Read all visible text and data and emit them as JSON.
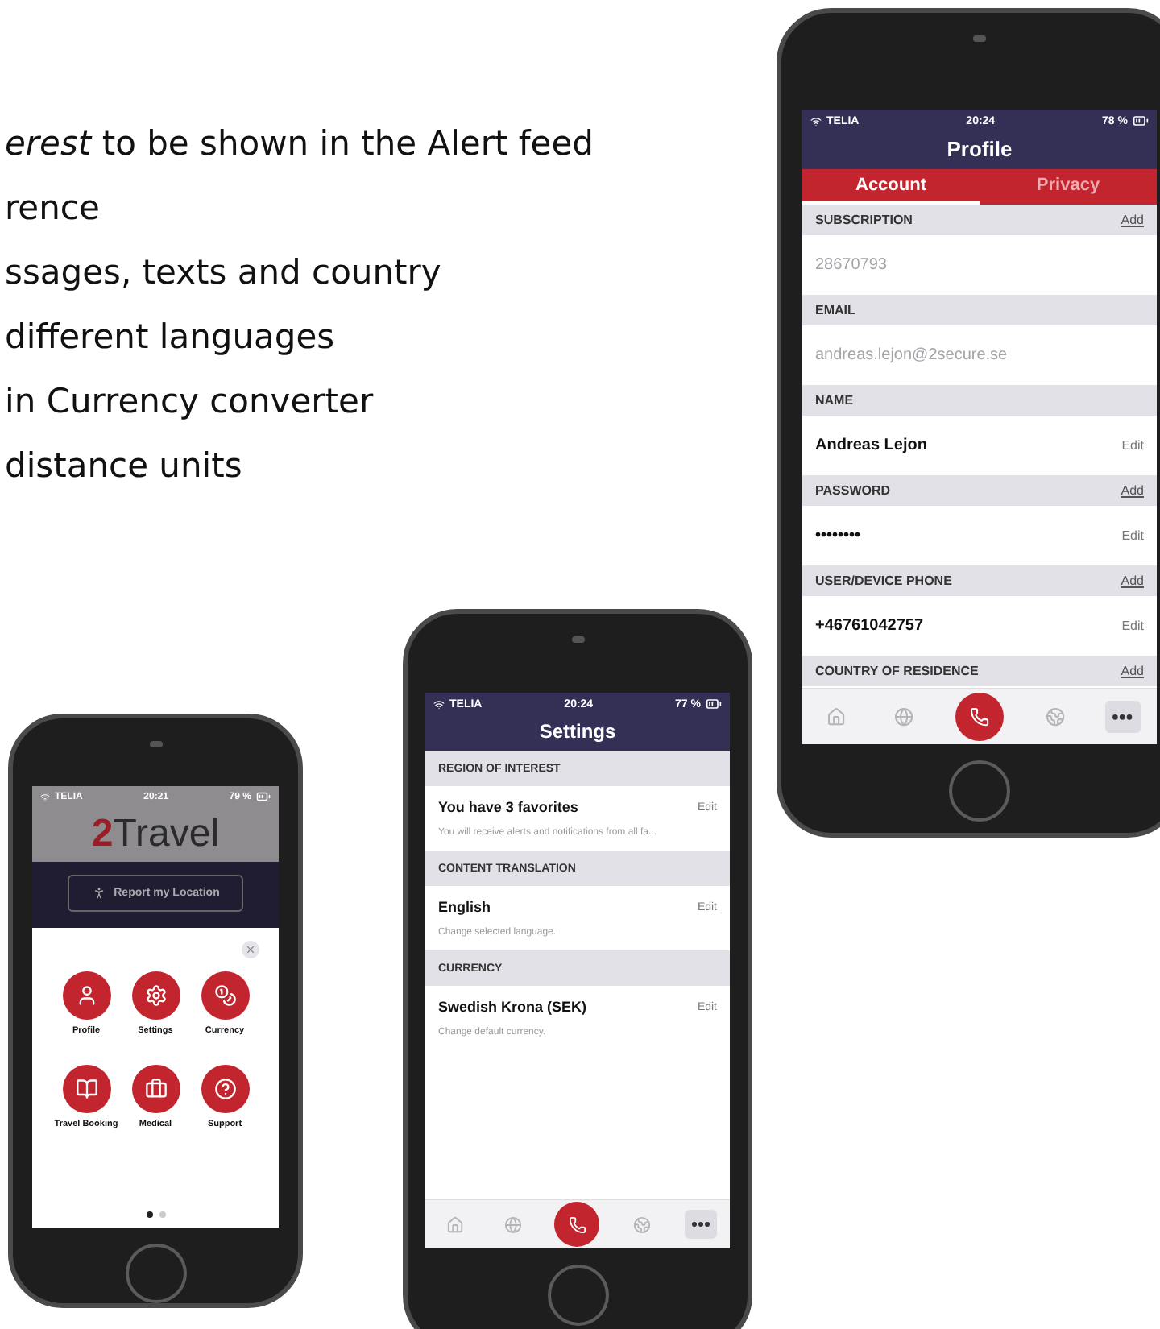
{
  "slide_text": [
    "*erest* to be shown in the Alert feed",
    "rence",
    "ssages, texts and country",
    "different languages",
    "in Currency converter",
    "distance units"
  ],
  "menu_phone": {
    "status": {
      "carrier": "TELIA",
      "time": "20:21",
      "battery": "79 %"
    },
    "logo": {
      "mark": "2",
      "text": "Travel"
    },
    "report_button": "Report my Location",
    "tiles": [
      {
        "label": "Profile"
      },
      {
        "label": "Settings"
      },
      {
        "label": "Currency"
      },
      {
        "label": "Travel Booking"
      },
      {
        "label": "Medical"
      },
      {
        "label": "Support"
      }
    ],
    "page_dots": [
      {
        "selected": true
      },
      {
        "selected": false
      }
    ]
  },
  "settings_phone": {
    "status": {
      "carrier": "TELIA",
      "time": "20:24",
      "battery": "77 %"
    },
    "title": "Settings",
    "sections": [
      {
        "header": "REGION OF INTEREST",
        "value": "You have 3 favorites",
        "action": "Edit",
        "note": "You will receive alerts and notifications from all fa..."
      },
      {
        "header": "CONTENT TRANSLATION",
        "value": "English",
        "action": "Edit",
        "note": "Change selected language."
      },
      {
        "header": "CURRENCY",
        "value": "Swedish Krona (SEK)",
        "action": "Edit",
        "note": "Change default currency."
      }
    ],
    "tab_bar": [
      {
        "selected": false
      },
      {
        "selected": false
      },
      {
        "selected": true
      },
      {
        "selected": false
      },
      {
        "selected": false
      }
    ]
  },
  "profile_phone": {
    "status": {
      "carrier": "TELIA",
      "time": "20:24",
      "battery": "78 %"
    },
    "title": "Profile",
    "tabs": [
      {
        "label": "Account",
        "selected": true
      },
      {
        "label": "Privacy",
        "selected": false
      }
    ],
    "sections": [
      {
        "header": "SUBSCRIPTION",
        "header_action": "Add",
        "value": "28670793",
        "muted": true
      },
      {
        "header": "EMAIL",
        "value": "andreas.lejon@2secure.se",
        "muted": true
      },
      {
        "header": "NAME",
        "value": "Andreas Lejon",
        "muted": false,
        "action": "Edit"
      },
      {
        "header": "PASSWORD",
        "header_action": "Add",
        "value": "••••••••",
        "muted": false,
        "action": "Edit"
      },
      {
        "header": "USER/DEVICE PHONE",
        "header_action": "Add",
        "value": "+46761042757",
        "muted": false,
        "action": "Edit"
      },
      {
        "header": "COUNTRY OF RESIDENCE",
        "header_action": "Add"
      }
    ],
    "tab_bar": [
      {
        "selected": false
      },
      {
        "selected": false
      },
      {
        "selected": true
      },
      {
        "selected": false
      },
      {
        "selected": false
      }
    ]
  }
}
